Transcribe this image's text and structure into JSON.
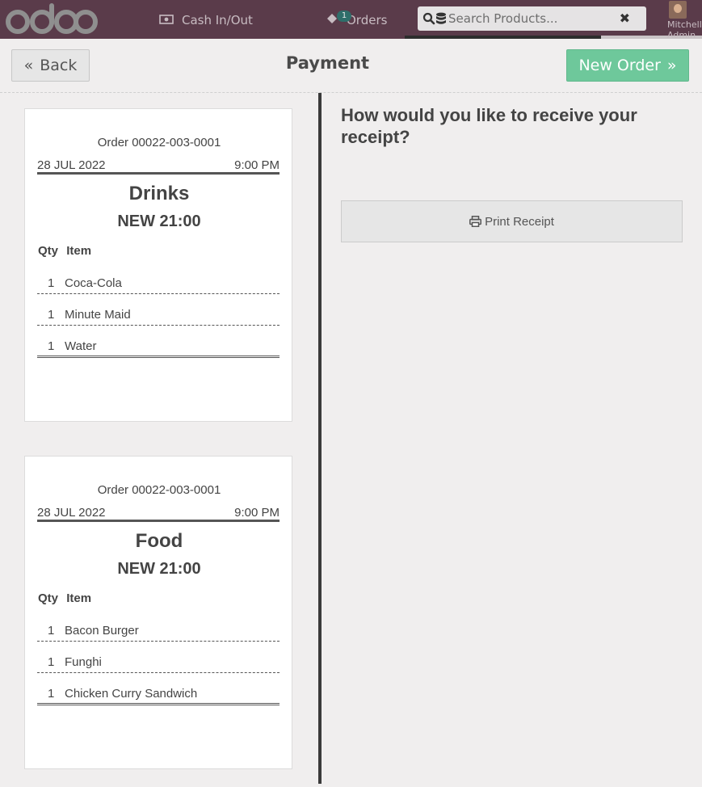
{
  "topbar": {
    "logo_text": "odoo",
    "cash_label": "Cash In/Out",
    "orders_label": "Orders",
    "orders_badge": "1",
    "search_placeholder": "Search Products...",
    "user_name": "Mitchell Admin"
  },
  "control": {
    "back_label": "Back",
    "title": "Payment",
    "new_order_label": "New Order"
  },
  "tickets": [
    {
      "order": "Order 00022-003-0001",
      "date": "28 JUL 2022",
      "time": "9:00 PM",
      "category": "Drinks",
      "status": "NEW 21:00",
      "qty_header": "Qty",
      "item_header": "Item",
      "items": [
        {
          "qty": "1",
          "name": "Coca-Cola"
        },
        {
          "qty": "1",
          "name": "Minute Maid"
        },
        {
          "qty": "1",
          "name": "Water"
        }
      ]
    },
    {
      "order": "Order 00022-003-0001",
      "date": "28 JUL 2022",
      "time": "9:00 PM",
      "category": "Food",
      "status": "NEW 21:00",
      "qty_header": "Qty",
      "item_header": "Item",
      "items": [
        {
          "qty": "1",
          "name": "Bacon Burger"
        },
        {
          "qty": "1",
          "name": "Funghi"
        },
        {
          "qty": "1",
          "name": "Chicken Curry Sandwich"
        }
      ]
    }
  ],
  "receipt": {
    "question": "How would you like to receive your receipt?",
    "print_label": "Print Receipt"
  },
  "colors": {
    "topbar": "#5a3b4a",
    "new_order": "#6ec89b",
    "background": "#f0eeee"
  }
}
